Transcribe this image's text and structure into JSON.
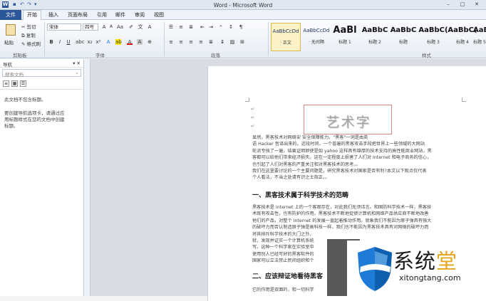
{
  "window": {
    "title": "Word - Microsoft Word",
    "app_icon": "W",
    "min": "–",
    "max": "□",
    "close": "✕"
  },
  "quick_access": [
    "↶",
    "↷",
    "▾"
  ],
  "tabs": {
    "file": "文件",
    "items": [
      "开始",
      "插入",
      "页面布局",
      "引用",
      "邮件",
      "审阅",
      "视图"
    ]
  },
  "clipboard": {
    "paste": "粘贴",
    "cut": "剪切",
    "copy": "复制",
    "format_painter": "格式刷",
    "group": "剪贴板"
  },
  "font": {
    "name": "宋体",
    "size": "四号",
    "group": "字体",
    "bold": "B",
    "italic": "I",
    "underline": "U",
    "grow": "A",
    "shrink": "A"
  },
  "paragraph": {
    "group": "段落"
  },
  "styles": {
    "group": "样式",
    "items": [
      {
        "preview": "AaBbCcDd",
        "label": "· 正文"
      },
      {
        "preview": "AaBbCcDd",
        "label": "· 无间隔"
      },
      {
        "preview": "AaBl",
        "label": "标题 1"
      },
      {
        "preview": "AaBbC",
        "label": "标题 2"
      },
      {
        "preview": "AaBbC",
        "label": "标题"
      },
      {
        "preview": "AaBbC(",
        "label": "标题 3"
      },
      {
        "preview": "AaBbC(",
        "label": "标题 4"
      },
      {
        "preview": "AaBbC",
        "label": "标题 5"
      }
    ]
  },
  "nav": {
    "title": "导航",
    "search_placeholder": "搜索文档",
    "no_headings": "此文档不包含标题。",
    "hint": [
      "要创建导航选项卡，请通过应",
      "用标题样式在您的文档中创建",
      "标题。"
    ]
  },
  "doc": {
    "art_text": "艺术字",
    "lines1": [
      "显然，黑客技术对网络安                              安全保障能力。\"黑客\"一词是由英",
      "语 Hacker 音译出来的。近段时间，一个普遍的黑客攻击手段把世界上一些领域的大网站",
      "轮流专挡了一遍，结果证明即使是如 yahoo 这样具有雄厚的技术支持的高性能商业网站，黑",
      "客都可以给他们带来经济损失。这在一定程度上损害了人们对 Internet 和电子商务的信心，",
      "也引起了人们对黑客的严重关注和对黑客技术的思考。。",
      "我们在这里要讨论的一个主要问题是，研究黑客技术对国家是否有利?本文以下观点仅代表",
      "个人看法，不当之处请有识之士指正。。"
    ],
    "h1": "一、黑客技术属于科学技术的范畴",
    "lines2": [
      "黑客技术是 Internet 上的一个客观存在，对此我们无须讳言。和国防科学技术一样，黑客技",
      "术既有攻击性，也有防护的作用。黑客技术不断地促使计算机和网络产品供应商不断地改善",
      "他们的产品，对整个 Internet 的发展一直起着推动作用。就象我们不能因为原子弹具有强大",
      "的破坏力而否认制造原子弹是高科技一样，我们也不能因为黑客技术具有对网络的破坏力而",
      "将其排斥科学技术的大门之外。",
      "就，发现并证实一个计算机系统",
      "写。这种一个科学家在实验室中",
      "使用别人已经写好的黑客软件的",
      "国家可以立法禁止民间组织和个"
    ],
    "h2": "二、应该辩证地看待黑客",
    "line_last": "它的作用是双面的，和一切科学"
  },
  "watermark": {
    "cn_a": "系统",
    "cn_b": "堂",
    "en": "xitongtang.com"
  }
}
